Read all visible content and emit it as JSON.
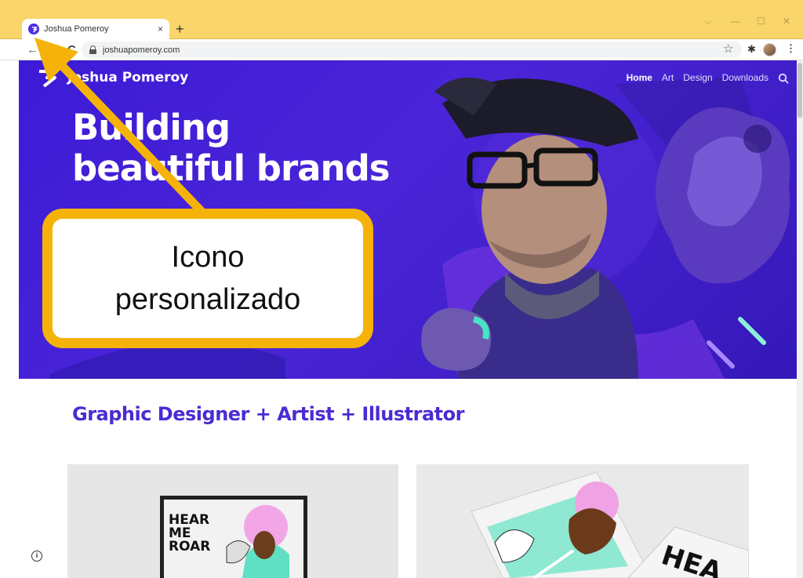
{
  "browser": {
    "tab_title": "Joshua Pomeroy",
    "url": "joshuapomeroy.com",
    "new_tab_label": "+",
    "close_label": "×"
  },
  "site": {
    "name": "Joshua Pomeroy",
    "nav": [
      "Home",
      "Art",
      "Design",
      "Downloads"
    ],
    "headline_lines": [
      "Building",
      "beautiful brands"
    ],
    "tagline": "Graphic Designer + Artist + Illustrator",
    "poster_words": [
      "HEAR",
      "ME",
      "ROAR"
    ],
    "card2_text": "HEA",
    "brand_color": "#4b2bd3"
  },
  "annotation": {
    "lines": [
      "Icono",
      "personalizado"
    ],
    "color": "#f5b30a"
  }
}
